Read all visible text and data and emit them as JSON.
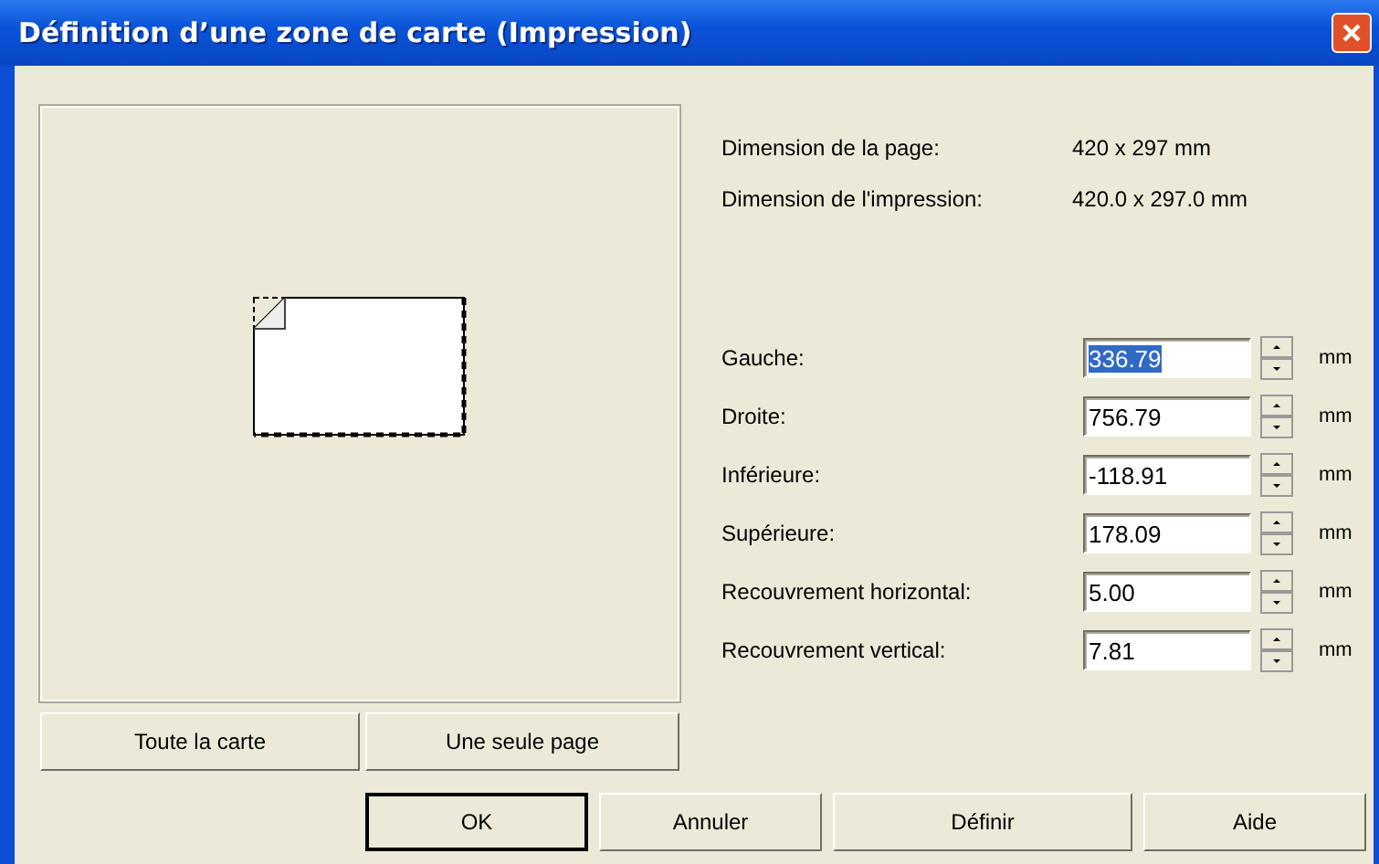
{
  "window": {
    "title": "Définition d’une zone de carte (Impression)"
  },
  "info": [
    {
      "label": "Dimension de la page:",
      "value": "420 x 297 mm"
    },
    {
      "label": "Dimension de l'impression:",
      "value": "420.0 x 297.0 mm"
    }
  ],
  "fields": [
    {
      "label": "Gauche:",
      "value": "336.79",
      "unit": "mm",
      "highlighted": true
    },
    {
      "label": "Droite:",
      "value": "756.79",
      "unit": "mm",
      "highlighted": false
    },
    {
      "label": "Inférieure:",
      "value": "-118.91",
      "unit": "mm",
      "highlighted": false
    },
    {
      "label": "Supérieure:",
      "value": "178.09",
      "unit": "mm",
      "highlighted": false
    },
    {
      "label": "Recouvrement horizontal:",
      "value": "5.00",
      "unit": "mm",
      "highlighted": false
    },
    {
      "label": "Recouvrement vertical:",
      "value": "7.81",
      "unit": "mm",
      "highlighted": false
    }
  ],
  "preview_buttons": [
    "Toute la carte",
    "Une seule page"
  ],
  "buttons": [
    {
      "label": "OK",
      "default": true
    },
    {
      "label": "Annuler",
      "default": false
    },
    {
      "label": "Définir",
      "default": false
    },
    {
      "label": "Aide",
      "default": false
    }
  ]
}
